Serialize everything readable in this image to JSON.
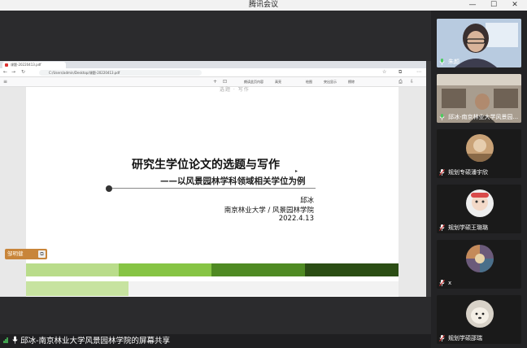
{
  "window": {
    "title": "腾讯会议",
    "controls": [
      "—",
      "☐",
      "✕"
    ]
  },
  "browser": {
    "tab_title": "课题-20220413.pdf",
    "address": "C:/Users/admin/Desktop/课题-20220413.pdf",
    "toolbar_items": [
      "添加文本",
      "绘图",
      "突出显示",
      "擦除",
      "页面视图",
      "朗读此页内容",
      "高亮"
    ],
    "prev_page_text": "选题 · 写作"
  },
  "slide": {
    "title": "研究生学位论文的选题与写作",
    "subtitle": "——以风景园林学科领域相关学位为例",
    "author": "邱冰",
    "org": "南京林业大学 / 风景园林学院",
    "date": "2022.4.13",
    "bar_colors": [
      "#b9dc8a",
      "#86c444",
      "#4f8a23",
      "#2b4d14"
    ]
  },
  "speaker": {
    "name": "邹明健"
  },
  "share_label": "邱冰-南京林业大学风景园林学院的屏幕共享",
  "participants": [
    {
      "name": "朱颜",
      "kind": "video-person"
    },
    {
      "name": "邱冰-南京林业大学风景园...",
      "kind": "video-room"
    },
    {
      "name": "规划专硕潘宇欣",
      "kind": "avatar"
    },
    {
      "name": "规划学硕王璐璐",
      "kind": "avatar"
    },
    {
      "name": "x",
      "kind": "avatar"
    },
    {
      "name": "规划学硕邵瑞",
      "kind": "avatar"
    }
  ]
}
